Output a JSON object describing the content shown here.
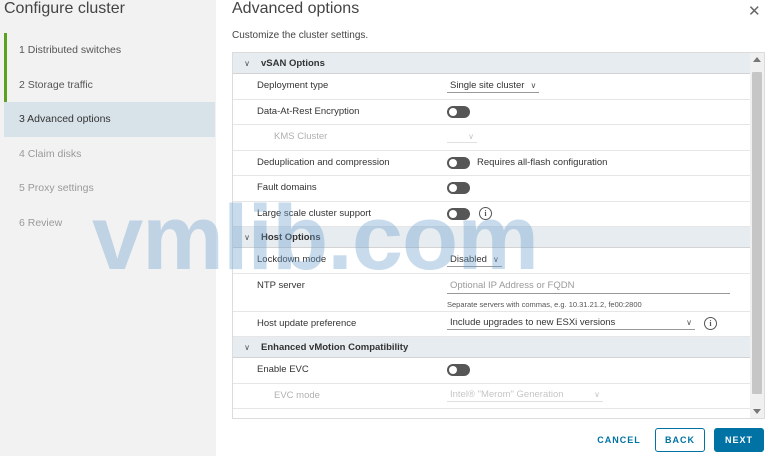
{
  "sidebar": {
    "title": "Configure cluster",
    "steps": [
      {
        "label": "1  Distributed switches"
      },
      {
        "label": "2  Storage traffic"
      },
      {
        "label": "3  Advanced options"
      },
      {
        "label": "4  Claim disks"
      },
      {
        "label": "5  Proxy settings"
      },
      {
        "label": "6  Review"
      }
    ]
  },
  "main": {
    "title": "Advanced options",
    "subtitle": "Customize the cluster settings.",
    "close_icon": "close-icon"
  },
  "sections": {
    "vsan": {
      "label": "vSAN Options",
      "deployment_type": {
        "label": "Deployment type",
        "value": "Single site cluster"
      },
      "encryption": {
        "label": "Data-At-Rest Encryption"
      },
      "kms_cluster": {
        "label": "KMS Cluster"
      },
      "dedup": {
        "label": "Deduplication and compression",
        "note": "Requires all-flash configuration"
      },
      "fault_domains": {
        "label": "Fault domains"
      },
      "large_scale": {
        "label": "Large scale cluster support"
      }
    },
    "host": {
      "label": "Host Options",
      "lockdown": {
        "label": "Lockdown mode",
        "value": "Disabled"
      },
      "ntp": {
        "label": "NTP server",
        "placeholder": "Optional IP Address or FQDN",
        "help": "Separate servers with commas, e.g. 10.31.21.2, fe00:2800"
      },
      "update_pref": {
        "label": "Host update preference",
        "value": "Include upgrades to new ESXi versions"
      }
    },
    "evc": {
      "label": "Enhanced vMotion Compatibility",
      "enable": {
        "label": "Enable EVC"
      },
      "mode": {
        "label": "EVC mode",
        "value": "Intel® \"Merom\" Generation"
      }
    }
  },
  "buttons": {
    "cancel": "CANCEL",
    "back": "BACK",
    "next": "NEXT"
  },
  "watermark": "vmlib.com",
  "colors": {
    "accent": "#0072a3",
    "step_done": "#5aa220",
    "step_active_bg": "#d8e3e9",
    "toggle_off": "#565656"
  }
}
